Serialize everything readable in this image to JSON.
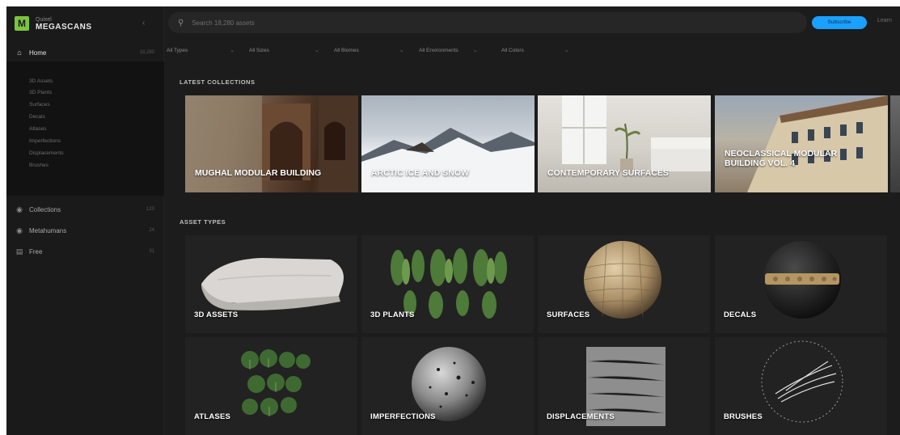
{
  "brand": {
    "sub": "Quixel",
    "main": "MEGASCANS",
    "accent": "#7cc43f"
  },
  "sidebar": {
    "home": {
      "label": "Home",
      "count": "18,280"
    },
    "sub_items": [
      "3D Assets",
      "3D Plants",
      "Surfaces",
      "Decals",
      "Atlases",
      "Imperfections",
      "Displacements",
      "Brushes"
    ],
    "items": [
      {
        "label": "Collections",
        "count": "120"
      },
      {
        "label": "Metahumans",
        "count": "24"
      },
      {
        "label": "Free",
        "count": "31"
      }
    ]
  },
  "search": {
    "placeholder": "Search 18,280 assets"
  },
  "header": {
    "subscribe_label": "Subscribe",
    "link_label": "Learn"
  },
  "filters": [
    "All Types",
    "All Sizes",
    "All Biomes",
    "All Environments",
    "All Colors"
  ],
  "sections": {
    "collections_title": "LATEST COLLECTIONS",
    "asset_types_title": "ASSET TYPES"
  },
  "collections": [
    {
      "title": "MUGHAL MODULAR BUILDING"
    },
    {
      "title": "ARCTIC ICE AND SNOW"
    },
    {
      "title": "CONTEMPORARY SURFACES"
    },
    {
      "title": "NEOCLASSICAL MODULAR BUILDING VOL. 4"
    }
  ],
  "asset_types": [
    {
      "label": "3D ASSETS"
    },
    {
      "label": "3D PLANTS"
    },
    {
      "label": "SURFACES"
    },
    {
      "label": "DECALS"
    },
    {
      "label": "ATLASES"
    },
    {
      "label": "IMPERFECTIONS"
    },
    {
      "label": "DISPLACEMENTS"
    },
    {
      "label": "BRUSHES"
    }
  ]
}
